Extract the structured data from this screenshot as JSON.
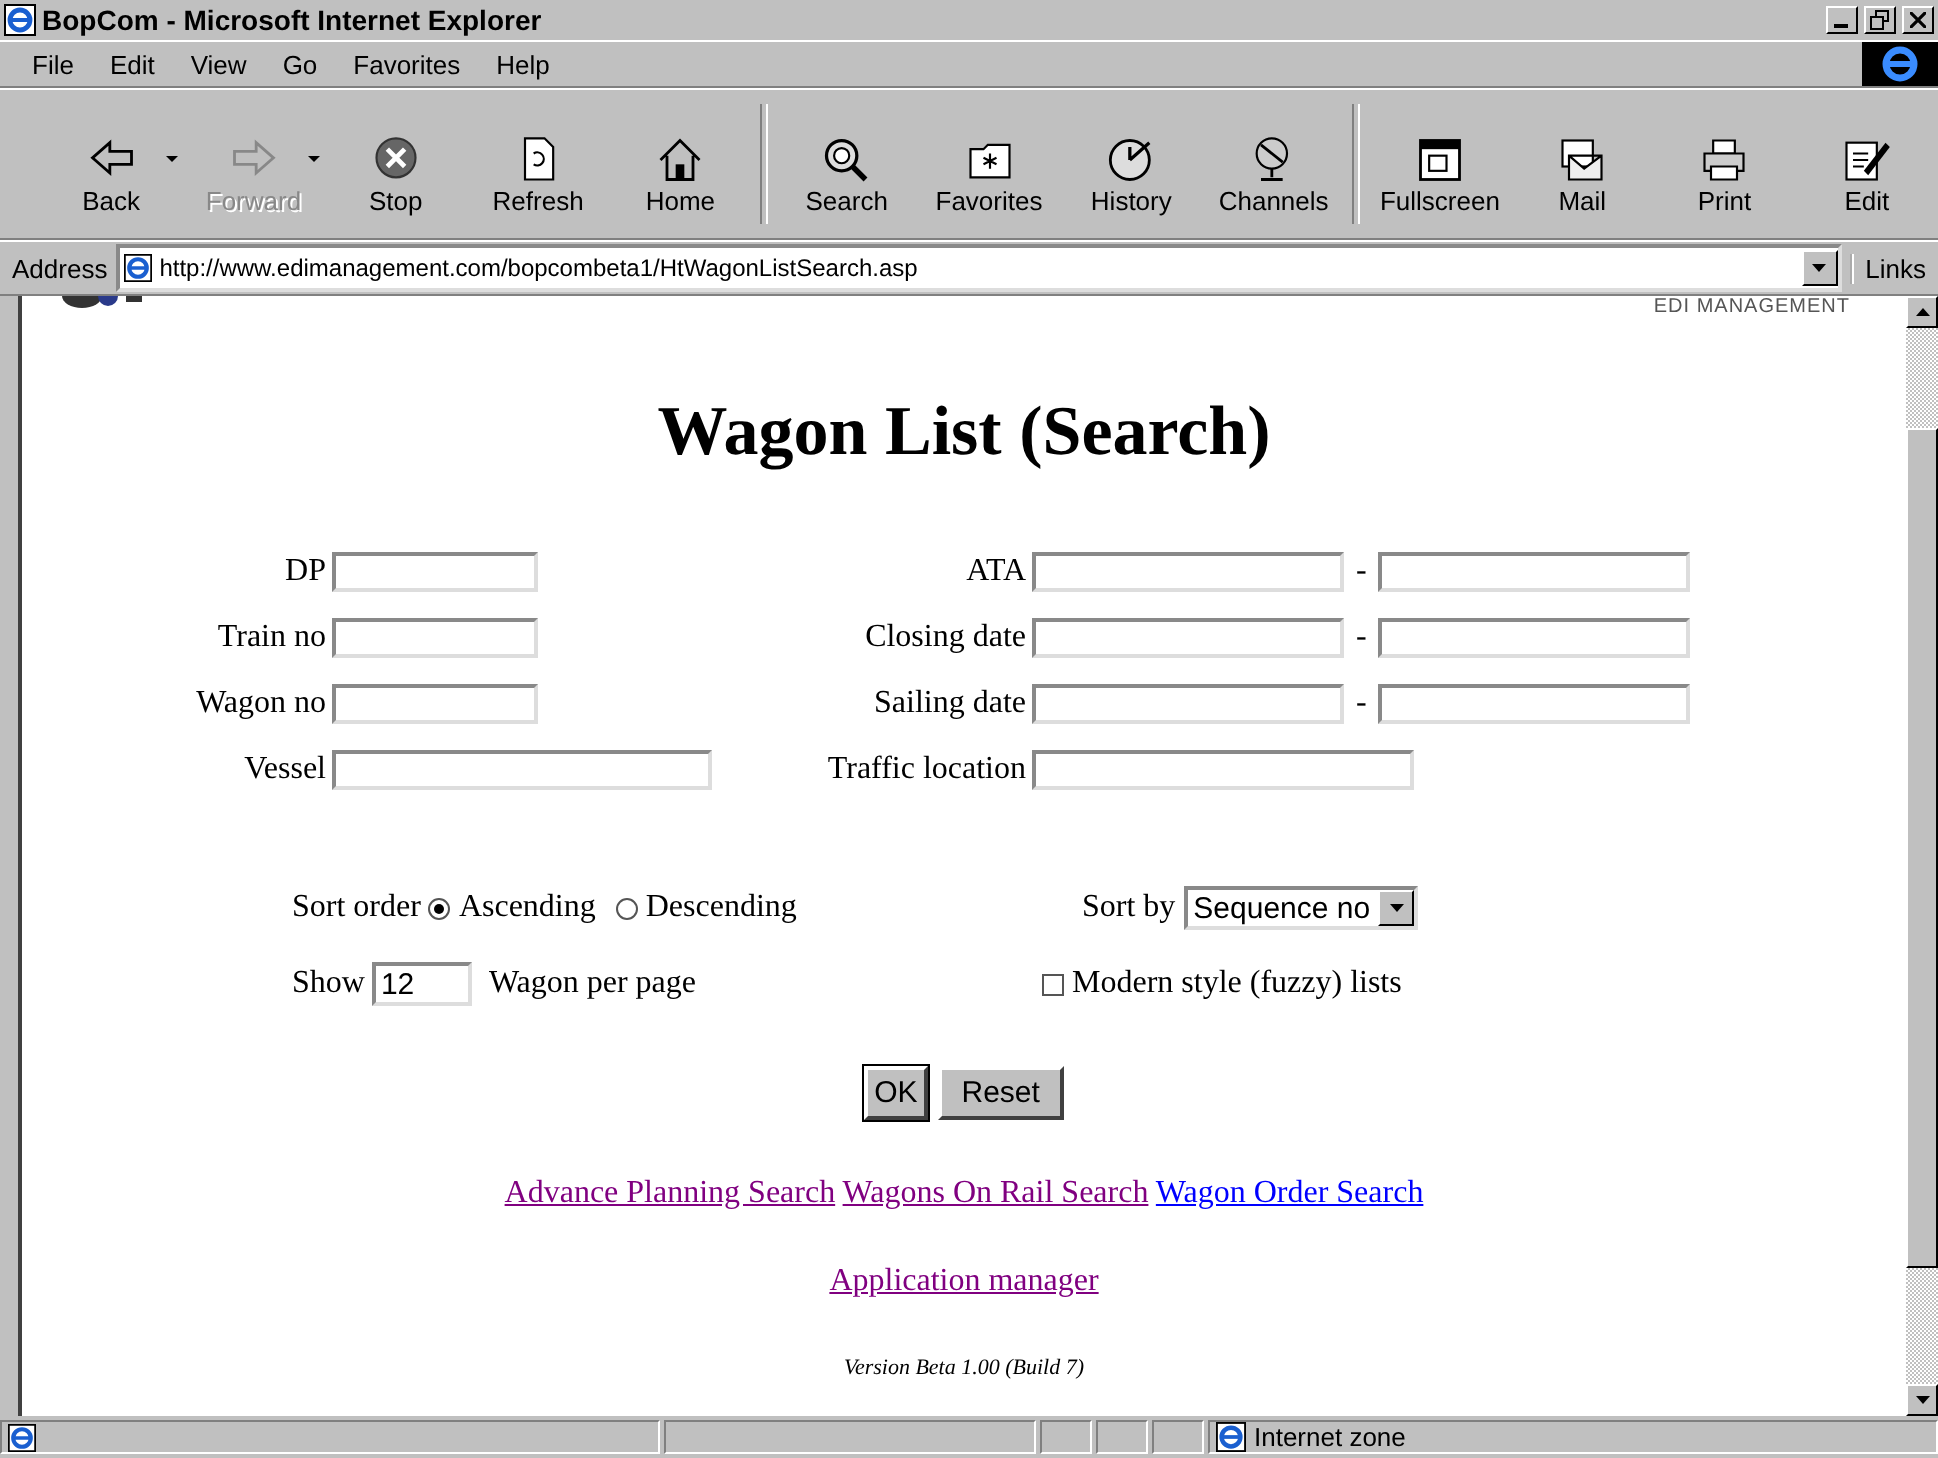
{
  "window": {
    "title": "BopCom - Microsoft Internet Explorer"
  },
  "menu": [
    "File",
    "Edit",
    "View",
    "Go",
    "Favorites",
    "Help"
  ],
  "toolbar": [
    {
      "label": "Back",
      "kind": "back",
      "disabled": false,
      "dropdown": true
    },
    {
      "label": "Forward",
      "kind": "forward",
      "disabled": true,
      "dropdown": true
    },
    {
      "label": "Stop",
      "kind": "stop",
      "disabled": false,
      "dropdown": false
    },
    {
      "label": "Refresh",
      "kind": "refresh",
      "disabled": false,
      "dropdown": false
    },
    {
      "label": "Home",
      "kind": "home",
      "disabled": false,
      "dropdown": false
    },
    {
      "label": "Search",
      "kind": "search",
      "disabled": false,
      "dropdown": false
    },
    {
      "label": "Favorites",
      "kind": "favorites",
      "disabled": false,
      "dropdown": false
    },
    {
      "label": "History",
      "kind": "history",
      "disabled": false,
      "dropdown": false
    },
    {
      "label": "Channels",
      "kind": "channels",
      "disabled": false,
      "dropdown": false
    },
    {
      "label": "Fullscreen",
      "kind": "fullscreen",
      "disabled": false,
      "dropdown": false
    },
    {
      "label": "Mail",
      "kind": "mail",
      "disabled": false,
      "dropdown": false
    },
    {
      "label": "Print",
      "kind": "print",
      "disabled": false,
      "dropdown": false
    },
    {
      "label": "Edit",
      "kind": "edit",
      "disabled": false,
      "dropdown": false
    }
  ],
  "address": {
    "label": "Address",
    "value": "http://www.edimanagement.com/bopcombeta1/HtWagonListSearch.asp",
    "links_label": "Links"
  },
  "page": {
    "brand": "EDI MANAGEMENT",
    "heading": "Wagon List (Search)",
    "fields_left": [
      {
        "label": "DP",
        "wide": false
      },
      {
        "label": "Train no",
        "wide": false
      },
      {
        "label": "Wagon no",
        "wide": false
      },
      {
        "label": "Vessel",
        "wide": true
      }
    ],
    "fields_right": [
      {
        "label": "ATA",
        "range": true
      },
      {
        "label": "Closing date",
        "range": true
      },
      {
        "label": "Sailing date",
        "range": true
      },
      {
        "label": "Traffic location",
        "range": false
      }
    ],
    "range_separator": "-",
    "sort_order": {
      "label": "Sort order",
      "options": [
        {
          "label": "Ascending",
          "selected": true
        },
        {
          "label": "Descending",
          "selected": false
        }
      ]
    },
    "sort_by": {
      "label": "Sort by",
      "value": "Sequence no"
    },
    "show": {
      "label": "Show",
      "value": "12",
      "suffix": "Wagon per page"
    },
    "modern_style": {
      "label": "Modern style (fuzzy) lists",
      "checked": false
    },
    "buttons": [
      "OK",
      "Reset"
    ],
    "links": [
      {
        "label": "Advance Planning Search",
        "visited": true
      },
      {
        "label": "Wagons On Rail Search",
        "visited": true
      },
      {
        "label": "Wagon Order Search",
        "visited": false
      }
    ],
    "app_link": {
      "label": "Application manager",
      "visited": true
    },
    "version": "Version Beta 1.00 (Build 7)"
  },
  "status_bar": {
    "zone": "Internet zone"
  }
}
